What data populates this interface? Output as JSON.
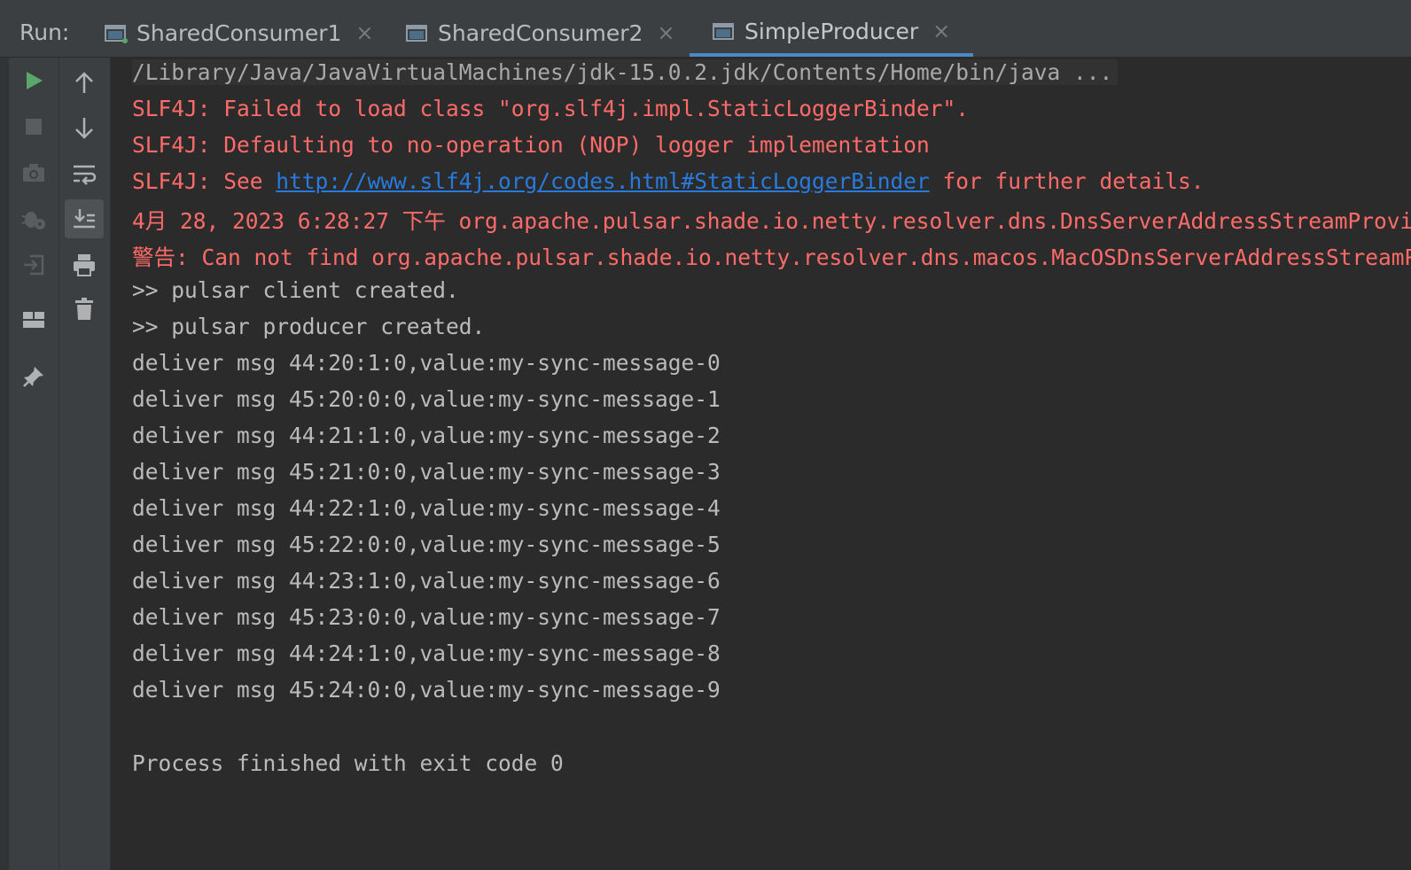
{
  "run_panel": {
    "label": "Run:",
    "tabs": [
      {
        "label": "SharedConsumer1",
        "close": "×"
      },
      {
        "label": "SharedConsumer2",
        "close": "×"
      },
      {
        "label": "SimpleProducer",
        "close": "×"
      }
    ],
    "active_tab": "SimpleProducer"
  },
  "toolbar_left": [
    {
      "icon": "play-icon",
      "enabled": true
    },
    {
      "icon": "stop-icon",
      "enabled": false
    },
    {
      "icon": "camera-icon",
      "enabled": false
    },
    {
      "icon": "debug-settings-icon",
      "enabled": false
    },
    {
      "icon": "login-icon",
      "enabled": false
    },
    {
      "icon": "layout-icon",
      "enabled": true
    },
    {
      "icon": "pin-icon",
      "enabled": true
    }
  ],
  "toolbar_right": [
    {
      "icon": "arrow-up-icon"
    },
    {
      "icon": "arrow-down-icon"
    },
    {
      "icon": "soft-wrap-icon"
    },
    {
      "icon": "scroll-to-end-icon",
      "selected": true
    },
    {
      "icon": "print-icon"
    },
    {
      "icon": "trash-icon"
    }
  ],
  "console": {
    "command": "/Library/Java/JavaVirtualMachines/jdk-15.0.2.jdk/Contents/Home/bin/java ...",
    "errors": {
      "line1": "SLF4J: Failed to load class \"org.slf4j.impl.StaticLoggerBinder\".",
      "line2": "SLF4J: Defaulting to no-operation (NOP) logger implementation",
      "line3_prefix": "SLF4J: See ",
      "line3_link": "http://www.slf4j.org/codes.html#StaticLoggerBinder",
      "line3_suffix": " for further details.",
      "line4": "4月 28, 2023 6:28:27 下午 org.apache.pulsar.shade.io.netty.resolver.dns.DnsServerAddressStreamProviders",
      "line5": "警告: Can not find org.apache.pulsar.shade.io.netty.resolver.dns.macos.MacOSDnsServerAddressStreamProvider"
    },
    "info": [
      ">> pulsar client created.",
      ">> pulsar producer created.",
      "deliver msg 44:20:1:0,value:my-sync-message-0",
      "deliver msg 45:20:0:0,value:my-sync-message-1",
      "deliver msg 44:21:1:0,value:my-sync-message-2",
      "deliver msg 45:21:0:0,value:my-sync-message-3",
      "deliver msg 44:22:1:0,value:my-sync-message-4",
      "deliver msg 45:22:0:0,value:my-sync-message-5",
      "deliver msg 44:23:1:0,value:my-sync-message-6",
      "deliver msg 45:23:0:0,value:my-sync-message-7",
      "deliver msg 44:24:1:0,value:my-sync-message-8",
      "deliver msg 45:24:0:0,value:my-sync-message-9"
    ],
    "exit": "Process finished with exit code 0"
  },
  "colors": {
    "background": "#2b2b2b",
    "panel": "#3c3f41",
    "error_text": "#ff6b68",
    "link": "#287bde",
    "normal_text": "#bbbbbb",
    "run_green": "#59a869",
    "active_tab_underline": "#4a88c7"
  }
}
